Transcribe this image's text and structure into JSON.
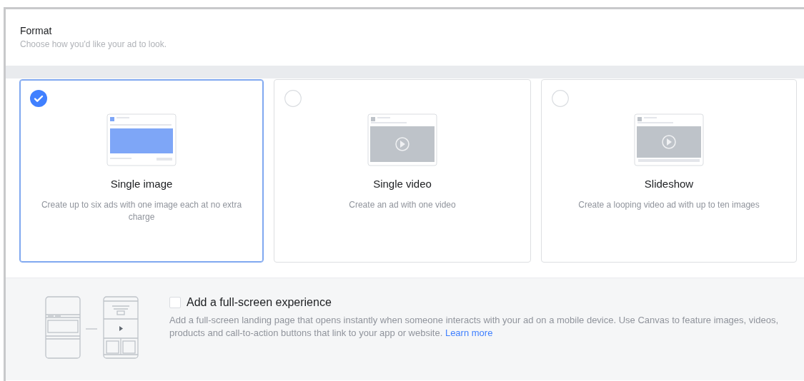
{
  "header": {
    "title": "Format",
    "subtitle": "Choose how you'd like your ad to look."
  },
  "formats": [
    {
      "kind": "image",
      "title": "Single image",
      "description": "Create up to six ads with one image each at no extra charge",
      "selected": true
    },
    {
      "kind": "video",
      "title": "Single video",
      "description": "Create an ad with one video",
      "selected": false
    },
    {
      "kind": "slideshow",
      "title": "Slideshow",
      "description": "Create a looping video ad with up to ten images",
      "selected": false
    }
  ],
  "full_screen": {
    "label": "Add a full-screen experience",
    "checked": false,
    "description": "Add a full-screen landing page that opens instantly when someone interacts with your ad on a mobile device. Use Canvas to feature images, videos, products and call-to-action buttons that link to your app or website.",
    "link": "Learn more"
  }
}
